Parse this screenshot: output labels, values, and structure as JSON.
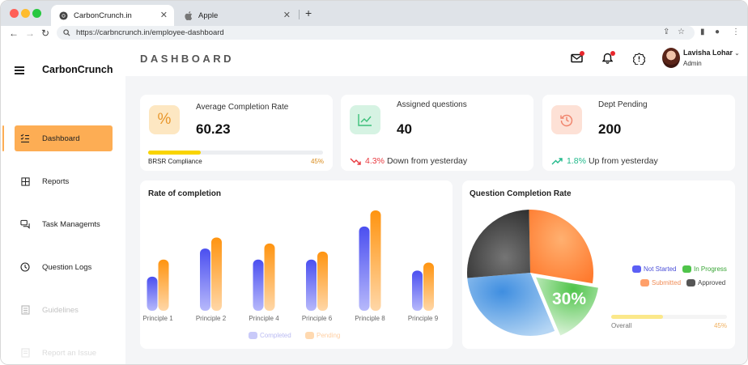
{
  "browser": {
    "tabs": [
      {
        "title": "CarbonCrunch.in",
        "active": true
      },
      {
        "title": "Apple",
        "active": false
      }
    ],
    "url": "https://carbncrunch.in/employee-dashboard"
  },
  "sidebar": {
    "brand": "CarbonCrunch",
    "items": [
      {
        "label": "Dashboard",
        "icon": "list-check-icon",
        "active": true
      },
      {
        "label": "Reports",
        "icon": "grid-icon"
      },
      {
        "label": "Task Managemts",
        "icon": "chat-icon"
      },
      {
        "label": "Question Logs",
        "icon": "clock-icon"
      },
      {
        "label": "Guidelines",
        "icon": "document-icon"
      },
      {
        "label": "Report an Issue",
        "icon": "flag-icon"
      }
    ]
  },
  "header": {
    "title": "DASHBOARD",
    "user": {
      "name": "Lavisha Lohar",
      "role": "Admin"
    }
  },
  "stats": {
    "completion": {
      "icon_text": "%",
      "title": "Average Completion Rate",
      "value": "60.23",
      "progress_label": "BRSR Compliance",
      "progress_text": "45%",
      "progress": 0.3
    },
    "assigned": {
      "title": "Assigned questions",
      "value": "40",
      "trend_value": "4.3%",
      "trend_text": "Down from yesterday"
    },
    "dept": {
      "title": "Dept Pending",
      "value": "200",
      "trend_value": "1.8%",
      "trend_text": "Up from yesterday"
    }
  },
  "bar_chart": {
    "title": "Rate of completion",
    "legend": [
      "Completed",
      "Pending"
    ]
  },
  "pie_chart": {
    "title": "Question Completion Rate",
    "center_label": "30%",
    "legend": [
      "Not Started",
      "In Progress",
      "Submitted",
      "Approved"
    ],
    "overall_label": "Overall",
    "overall_text": "45%",
    "overall_progress": 0.45
  },
  "chart_data": [
    {
      "type": "bar",
      "title": "Rate of completion",
      "categories": [
        "Principle 1",
        "Principle 2",
        "Principle 4",
        "Principle 6",
        "Principle 8",
        "Principle 9"
      ],
      "series": [
        {
          "name": "Completed",
          "values": [
            34,
            62,
            51,
            51,
            84,
            40
          ]
        },
        {
          "name": "Pending",
          "values": [
            51,
            73,
            67,
            59,
            100,
            48
          ]
        }
      ],
      "ylim": [
        0,
        100
      ]
    },
    {
      "type": "pie",
      "title": "Question Completion Rate",
      "labels": [
        "Submitted",
        "In Progress",
        "Not Started",
        "Approved"
      ],
      "values": [
        28,
        16,
        30,
        26
      ]
    }
  ],
  "colors": {
    "accent": "#fdad54",
    "completed": "#5b5ff5",
    "pending": "#ff9d1e",
    "pie_submitted": "#ff8a3d",
    "pie_in_progress": "#5ec95a",
    "pie_not_started": "#5aa0e6",
    "pie_approved": "#4a4a4a",
    "down": "#e8393f",
    "up": "#1fb98a"
  }
}
